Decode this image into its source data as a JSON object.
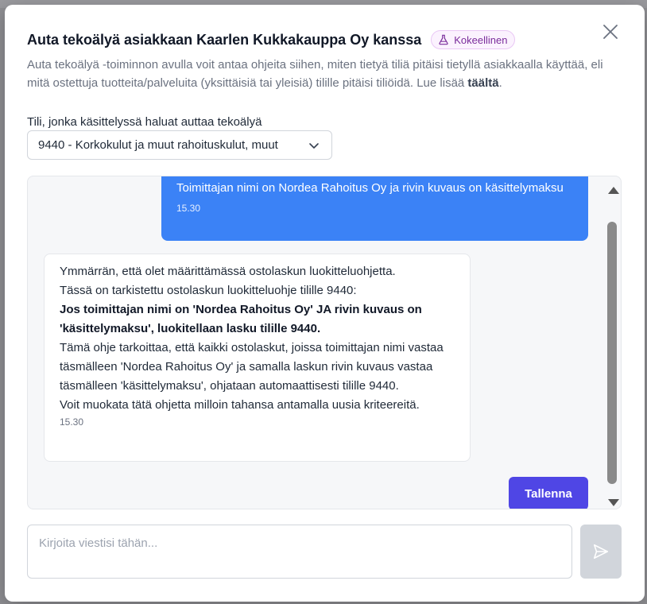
{
  "modal": {
    "title": "Auta tekoälyä asiakkaan Kaarlen Kukkakauppa Oy kanssa",
    "badge": "Kokeellinen",
    "description": "Auta tekoälyä -toiminnon avulla voit antaa ohjeita siihen, miten tietyä tiliä pitäisi tietyllä asiakkaalla käyttää, eli mitä ostettuja tuotteita/palveluita (yksittäisiä tai yleisiä) tilille pitäisi tiliöidä. Lue lisää",
    "description_link": "täältä",
    "description_end": "."
  },
  "account_field": {
    "label": "Tili, jonka käsittelyssä haluat auttaa tekoälyä",
    "value": "9440 - Korkokulut ja muut rahoituskulut, muut"
  },
  "chat": {
    "user_message": {
      "text": "Toimittajan nimi on Nordea Rahoitus Oy ja rivin kuvaus on käsittelymaksu",
      "time": "15.30"
    },
    "bot_message": {
      "line1": "Ymmärrän, että olet määrittämässä ostolaskun luokitteluohjetta.",
      "line2": "Tässä on tarkistettu ostolaskun luokitteluohje tilille 9440:",
      "rule": "Jos toimittajan nimi on 'Nordea Rahoitus Oy' JA rivin kuvaus on 'käsittelymaksu', luokitellaan lasku tilille 9440.",
      "line3": "Tämä ohje tarkoittaa, että kaikki ostolaskut, joissa toimittajan nimi vastaa täsmälleen 'Nordea Rahoitus Oy' ja samalla laskun rivin kuvaus vastaa täsmälleen 'käsittelymaksu', ohjataan automaattisesti tilille 9440.",
      "line4": "Voit muokata tätä ohjetta milloin tahansa antamalla uusia kriteereitä.",
      "time": "15.30"
    },
    "save_label": "Tallenna"
  },
  "composer": {
    "placeholder": "Kirjoita viestisi tähän..."
  },
  "colors": {
    "primary": "#4f46e5",
    "user_bubble": "#3b82f6",
    "badge_text": "#7a2c9b"
  }
}
